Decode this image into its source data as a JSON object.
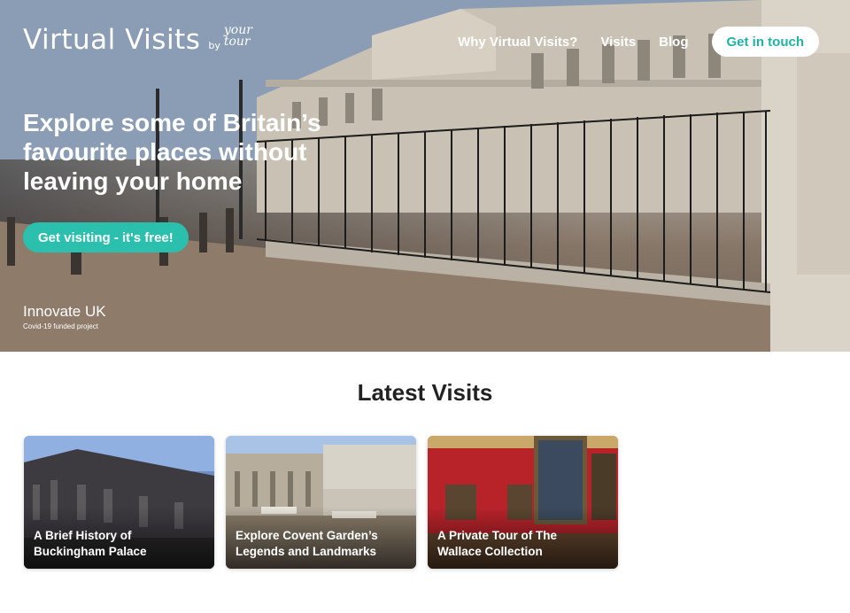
{
  "brand": {
    "name": "Virtual Visits",
    "by": "by",
    "partner": "your tour"
  },
  "nav": {
    "links": [
      "Why Virtual Visits?",
      "Visits",
      "Blog"
    ],
    "cta": "Get in touch"
  },
  "hero": {
    "headline": "Explore some of Britain’s favourite places without leaving your home",
    "cta": "Get visiting - it's free!",
    "sponsor_name": "Innovate UK",
    "sponsor_note": "Covid-19 funded project"
  },
  "latest": {
    "title": "Latest Visits",
    "cards": [
      {
        "line1": "A Brief History of",
        "line2": "Buckingham Palace"
      },
      {
        "line1": "Explore Covent Garden’s",
        "line2": "Legends and Landmarks"
      },
      {
        "line1": "A Private Tour of The",
        "line2": "Wallace Collection"
      }
    ]
  },
  "colors": {
    "accent": "#2bbfad",
    "accent_text": "#1fb3a6"
  }
}
